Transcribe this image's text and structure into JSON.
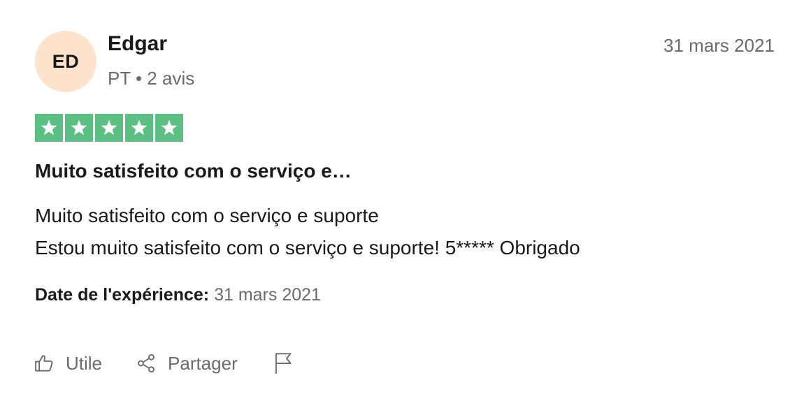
{
  "reviewer": {
    "initials": "ED",
    "name": "Edgar",
    "meta": "PT • 2 avis"
  },
  "review": {
    "date": "31 mars 2021",
    "rating": 5,
    "rating_max": 5,
    "star_color": "#5cbf84",
    "title": "Muito satisfeito com o serviço e…",
    "body_lines": [
      "Muito satisfeito com o serviço e suporte",
      "Estou muito satisfeito com o serviço e suporte! 5***** Obrigado"
    ],
    "experience_label": "Date de l'expérience:",
    "experience_date": "31 mars 2021"
  },
  "actions": {
    "useful_label": "Utile",
    "useful_icon": "thumbs-up-icon",
    "share_label": "Partager",
    "share_icon": "share-icon",
    "report_icon": "flag-icon"
  },
  "colors": {
    "avatar_bg": "#fde3cc",
    "muted_text": "#6b6b6b"
  }
}
